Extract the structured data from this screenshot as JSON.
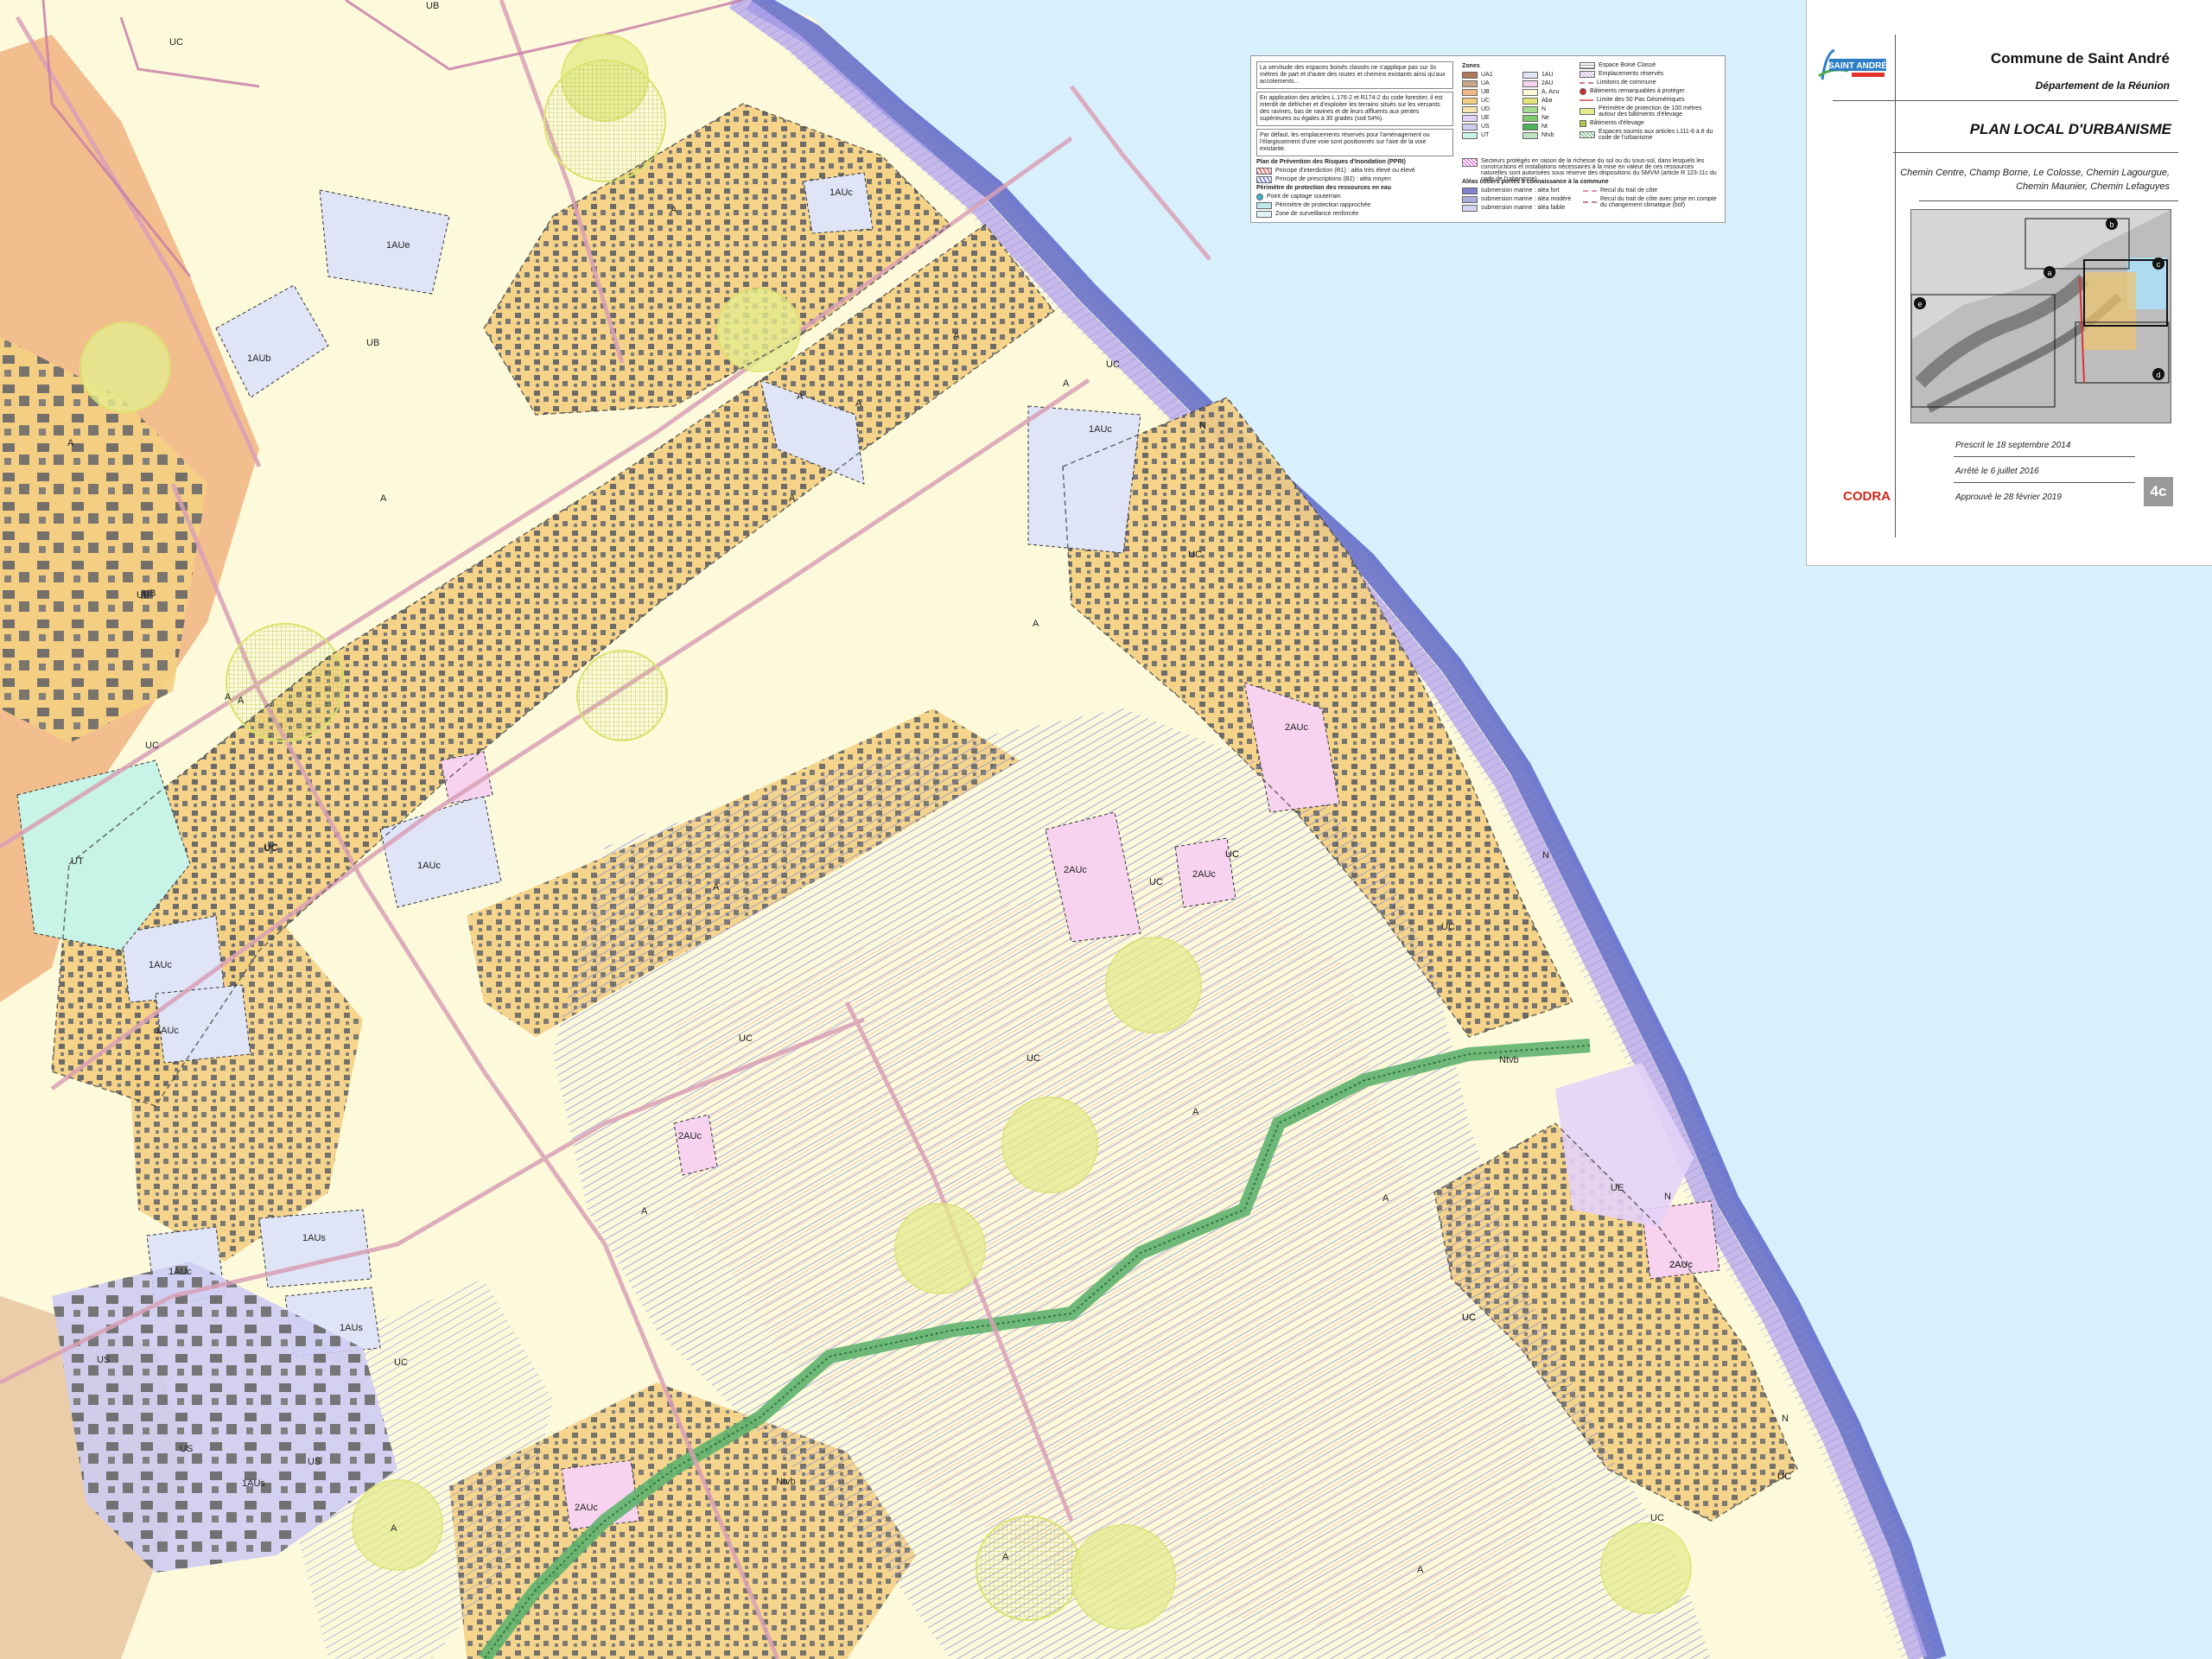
{
  "colors": {
    "sea": "#d8f0fb",
    "zone_A": "#fdfadb",
    "zone_UC": "#f4cf82",
    "zone_UB": "#f2b785",
    "zone_1AU": "#dfe5f7",
    "zone_2AU": "#f7d3ef",
    "zone_UT": "#c8f3e7",
    "zone_US": "#cfccf2",
    "zone_UE": "#e4d2f7",
    "zone_N": "#5fb26e",
    "ppri_hatch": "#8a8fd6",
    "protection_circle": "#d9e36a",
    "building": "#666666",
    "road": "#d9a0b6",
    "coast": "#5e66c8"
  },
  "zone_labels": [
    "UB",
    "UC",
    "A",
    "UB",
    "1AUb",
    "1AUe",
    "A",
    "UB",
    "A",
    "UC",
    "1AUc",
    "A",
    "A",
    "1AUc",
    "UC",
    "A",
    "A",
    "A",
    "UC",
    "A",
    "UC",
    "2AUc",
    "A",
    "UC",
    "A",
    "UT",
    "UC",
    "1AUc",
    "2AUc",
    "UC",
    "A",
    "1AUc",
    "UC",
    "1AUc",
    "2AUc",
    "UC",
    "2AUc",
    "UC",
    "2AUc",
    "UC",
    "A",
    "UC",
    "UC",
    "A",
    "A",
    "Ntvb",
    "A",
    "1AUc",
    "1AUs",
    "1AUs",
    "UE",
    "2AUc",
    "UC",
    "US",
    "UC",
    "1AUs",
    "US",
    "US",
    "UC",
    "A",
    "2AUc",
    "Ntvb",
    "UC",
    "A",
    "N",
    "N",
    "N",
    "N",
    "UB"
  ],
  "legend": {
    "ebc_note": "La servitude des espaces boisés classés ne s'applique pas sur 3x mètres de part et d'autre des routes et chemins existants ainsi qu'aux accotements...",
    "article_note": "En application des articles L.176-2 et R174-2 du code forestier, il est interdit de défricher et d'exploiter les terrains situés sur les versants des ravines, bas de ravines et de leurs affluents aux pentes supérieures ou égales à 30 grades (soit 54%).",
    "emplacement_note": "Par défaut, les emplacements réservés pour l'aménagement ou l'élargissement d'une voie sont positionnés sur l'axe de la voie existante.",
    "ppri_title": "Plan de Prévention des Risques d'Inondation (PPRI)",
    "ppri_items": [
      "Principe d'interdiction (R1) : aléa très élevé ou élevé",
      "Principe de prescriptions (B2) : aléa moyen"
    ],
    "eau_title": "Périmètre de protection des ressources en eau",
    "eau_items": [
      "Point de captage souterrain",
      "Périmètre de protection rapprochée",
      "Zone de surveillance renforcée"
    ],
    "zones_title": "Zones",
    "zones_col1": [
      "UA1",
      "UA",
      "UB",
      "UC",
      "UD",
      "UE",
      "US",
      "UT"
    ],
    "zones_col2": [
      "1AU",
      "2AU",
      "A, Acu",
      "Aba",
      "N",
      "Ne",
      "Nt",
      "Ntvb"
    ],
    "symbols": [
      "Espace Boisé Classé",
      "Emplacements réservés",
      "Limitons de commune",
      "Bâtiments remarquables à protéger",
      "Limite des 50 Pas Géométriques",
      "Périmètre de protection de 100 mètres autour des bâtiments d'élevage",
      "Bâtiments d'élevage",
      "Espaces soumis aux articles L111-6 à 8 du code de l'urbanisme"
    ],
    "secteurs_note": "Secteurs protégés en raison de la richesse du sol ou du sous-sol, dans lesquels les constructions et installations nécessaires à la mise en valeur de ces ressources naturelles sont autorisées sous réserve des dispositions du SMVM (article R 123-11c du code de l'urbanisme)",
    "aleas_title": "Aléas côtiers portés à connaissance à la commune",
    "aleas_items": [
      "submersion marine : aléa fort",
      "submersion marine : aléa modéré",
      "submersion marine : aléa faible"
    ],
    "recul_items": [
      "Recul du trait de côte",
      "Recul du trait de côte avec prise en compte du changement climatique (bof)"
    ]
  },
  "cartouche": {
    "commune": "Commune de Saint André",
    "departement": "Département de la Réunion",
    "title": "PLAN LOCAL D'URBANISME",
    "places": "Chemin Centre, Champ Borne, Le Colosse, Chemin Lagourgue, Chemin Maunier, Chemin Lefaguyes",
    "logo_text": "SAINT ANDRÉ",
    "inset_letters": [
      "a",
      "b",
      "c",
      "d",
      "e"
    ],
    "prescrit": "Prescrit le 18 septembre 2014",
    "arrete": "Arrêté le 6 juillet 2016",
    "approuve": "Approuvé le 28 février 2019",
    "agency": "CODRA",
    "sheet": "4c"
  }
}
